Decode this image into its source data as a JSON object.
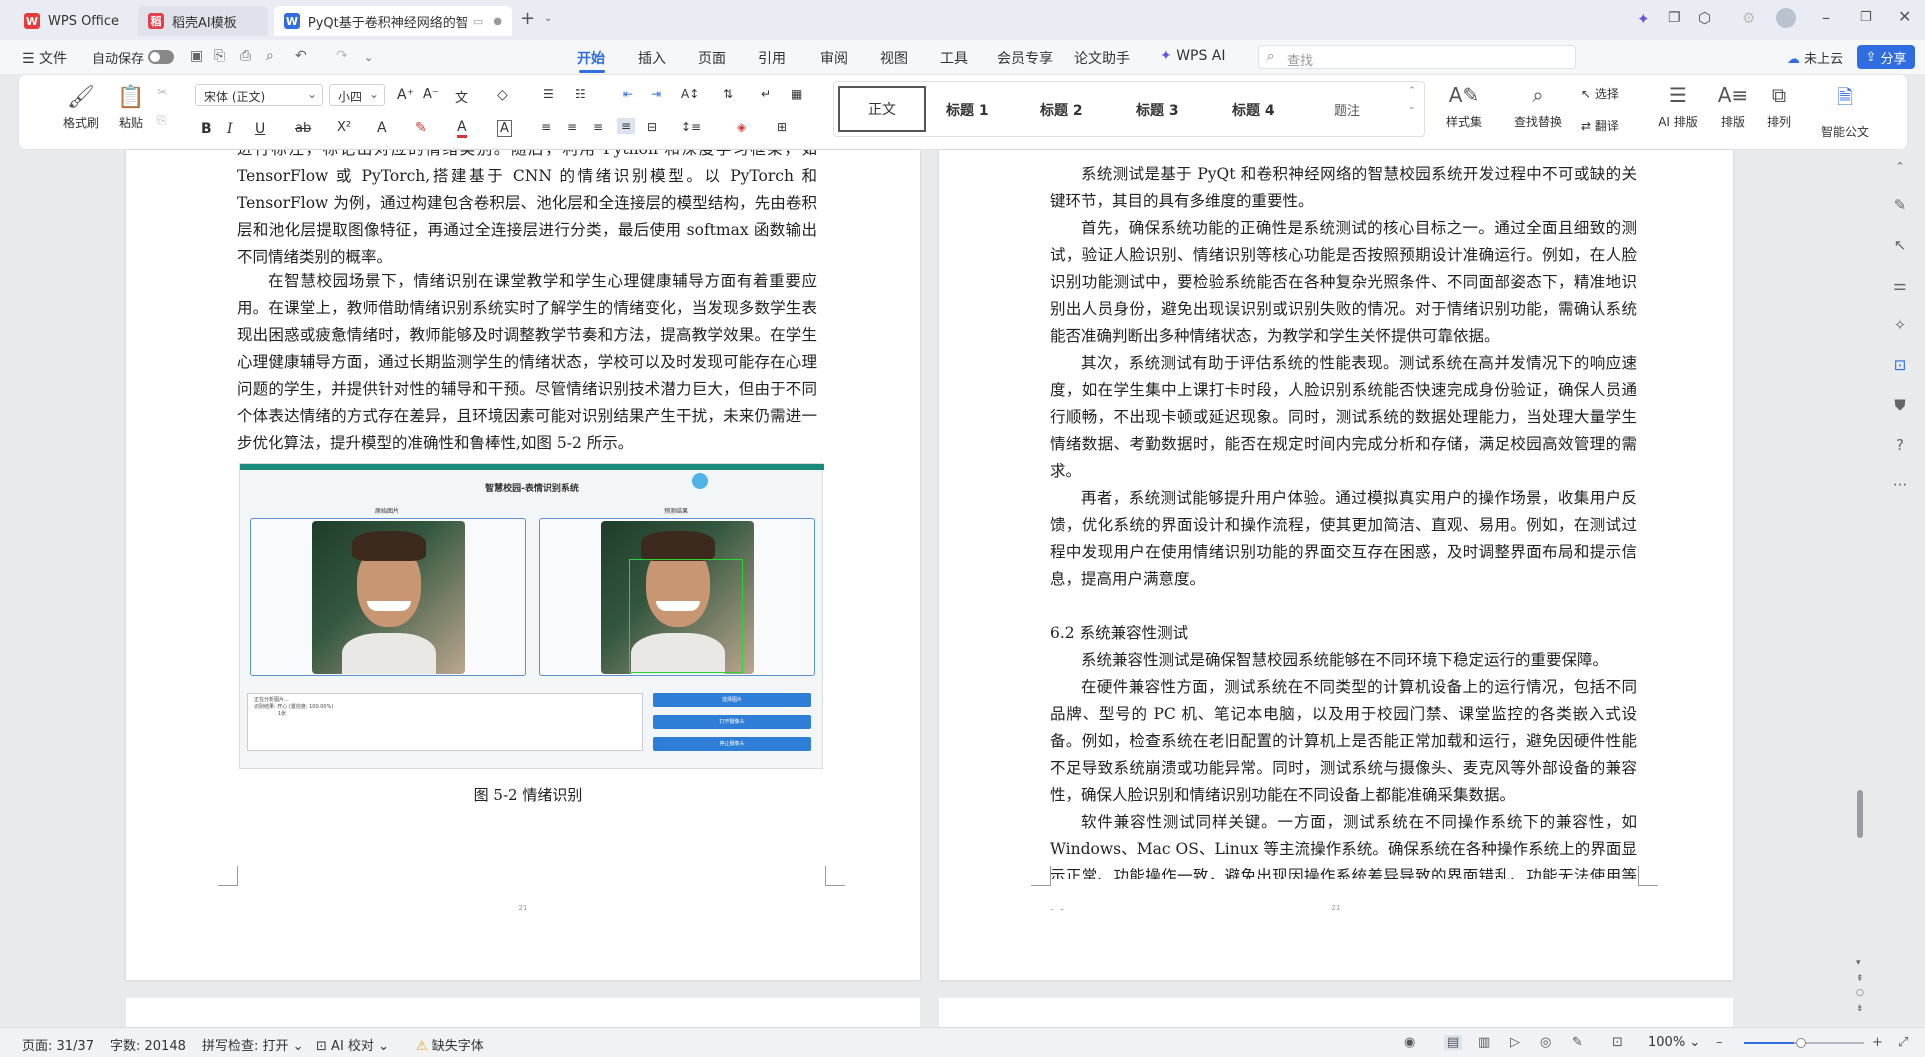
{
  "titlebar": {
    "tabs": [
      {
        "label": "WPS Office",
        "active": false
      },
      {
        "label": "稻壳AI模板",
        "active": false
      },
      {
        "label": "PyQt基于卷积神经网络的智",
        "active": true
      }
    ]
  },
  "menubar": {
    "file": "文件",
    "autosave": "自动保存",
    "tabs": [
      "开始",
      "插入",
      "页面",
      "引用",
      "审阅",
      "视图",
      "工具",
      "会员专享",
      "论文助手",
      "WPS AI"
    ],
    "active_tab": "开始",
    "search_placeholder": "查找",
    "cloud": "未上云",
    "share": "分享"
  },
  "ribbon": {
    "format_painter": "格式刷",
    "paste": "粘贴",
    "font_name": "宋体 (正文)",
    "font_size": "小四",
    "styles": [
      "正文",
      "标题 1",
      "标题 2",
      "标题 3",
      "标题 4",
      "题注"
    ],
    "style_set": "样式集",
    "find_replace": "查找替换",
    "select": "选择",
    "translate": "翻译",
    "ai_layout": "AI 排版",
    "layout": "排版",
    "arrange": "排列",
    "smart_doc": "智能公文"
  },
  "left_page": {
    "para1": "进行标注，标记出对应的情绪类别。随后，利用 Python 和深度学习框架，如 TensorFlow 或 PyTorch,搭建基于 CNN 的情绪识别模型。以 PyTorch 和 TensorFlow 为例，通过构建包含卷积层、池化层和全连接层的模型结构，先由卷积层和池化层提取图像特征，再通过全连接层进行分类，最后使用 softmax 函数输出不同情绪类别的概率。",
    "para2": "在智慧校园场景下，情绪识别在课堂教学和学生心理健康辅导方面有着重要应用。在课堂上，教师借助情绪识别系统实时了解学生的情绪变化，当发现多数学生表现出困惑或疲惫情绪时，教师能够及时调整教学节奏和方法，提高教学效果。在学生心理健康辅导方面，通过长期监测学生的情绪状态，学校可以及时发现可能存在心理问题的学生，并提供针对性的辅导和干预。尽管情绪识别技术潜力巨大，但由于不同个体表达情绪的方式存在差异，且环境因素可能对识别结果产生干扰，未来仍需进一步优化算法，提升模型的准确性和鲁棒性,如图 5-2 所示。",
    "figure": {
      "app_title": "智慧校园-表情识别系统",
      "left_label": "原始图片",
      "right_label": "预测结果",
      "log_lines": [
        "正在分析图片...",
        "识别结果: 开心 (置信度: 100.00%)",
        "1张"
      ],
      "buttons": [
        "选择图片",
        "打开摄像头",
        "停止摄像头"
      ]
    },
    "caption": "图 5-2 情绪识别",
    "page_number": "21"
  },
  "right_page": {
    "para1": "系统测试是基于 PyQt 和卷积神经网络的智慧校园系统开发过程中不可或缺的关键环节，其目的具有多维度的重要性。",
    "para2": "首先，确保系统功能的正确性是系统测试的核心目标之一。通过全面且细致的测试，验证人脸识别、情绪识别等核心功能是否按照预期设计准确运行。例如，在人脸识别功能测试中，要检验系统能否在各种复杂光照条件、不同面部姿态下，精准地识别出人员身份，避免出现误识别或识别失败的情况。对于情绪识别功能，需确认系统能否准确判断出多种情绪状态，为教学和学生关怀提供可靠依据。",
    "para3": "其次，系统测试有助于评估系统的性能表现。测试系统在高并发情况下的响应速度，如在学生集中上课打卡时段，人脸识别系统能否快速完成身份验证，确保人员通行顺畅，不出现卡顿或延迟现象。同时，测试系统的数据处理能力，当处理大量学生情绪数据、考勤数据时，能否在规定时间内完成分析和存储，满足校园高效管理的需求。",
    "para4": "再者，系统测试能够提升用户体验。通过模拟真实用户的操作场景，收集用户反馈，优化系统的界面设计和操作流程，使其更加简洁、直观、易用。例如，在测试过程中发现用户在使用情绪识别功能的界面交互存在困惑，及时调整界面布局和提示信息，提高用户满意度。",
    "heading": "6.2 系统兼容性测试",
    "para5": "系统兼容性测试是确保智慧校园系统能够在不同环境下稳定运行的重要保障。",
    "para6": "在硬件兼容性方面，测试系统在不同类型的计算机设备上的运行情况，包括不同品牌、型号的 PC 机、笔记本电脑，以及用于校园门禁、课堂监控的各类嵌入式设备。例如，检查系统在老旧配置的计算机上是否能正常加载和运行，避免因硬件性能不足导致系统崩溃或功能异常。同时，测试系统与摄像头、麦克风等外部设备的兼容性，确保人脸识别和情绪识别功能在不同设备上都能准确采集数据。",
    "para7": "软件兼容性测试同样关键。一方面，测试系统在不同操作系统下的兼容性，如 Windows、Mac OS、Linux 等主流操作系统。确保系统在各种操作系统上的界面显示正常、功能操作一致，避免出现因操作系统差异导致的界面错乱、功能无法使用等问",
    "page_number": "21"
  },
  "statusbar": {
    "page": "页面: 31/37",
    "words": "字数: 20148",
    "spell": "拼写检查: 打开",
    "ai_check": "AI 校对",
    "missing_font": "缺失字体",
    "zoom": "100%"
  }
}
